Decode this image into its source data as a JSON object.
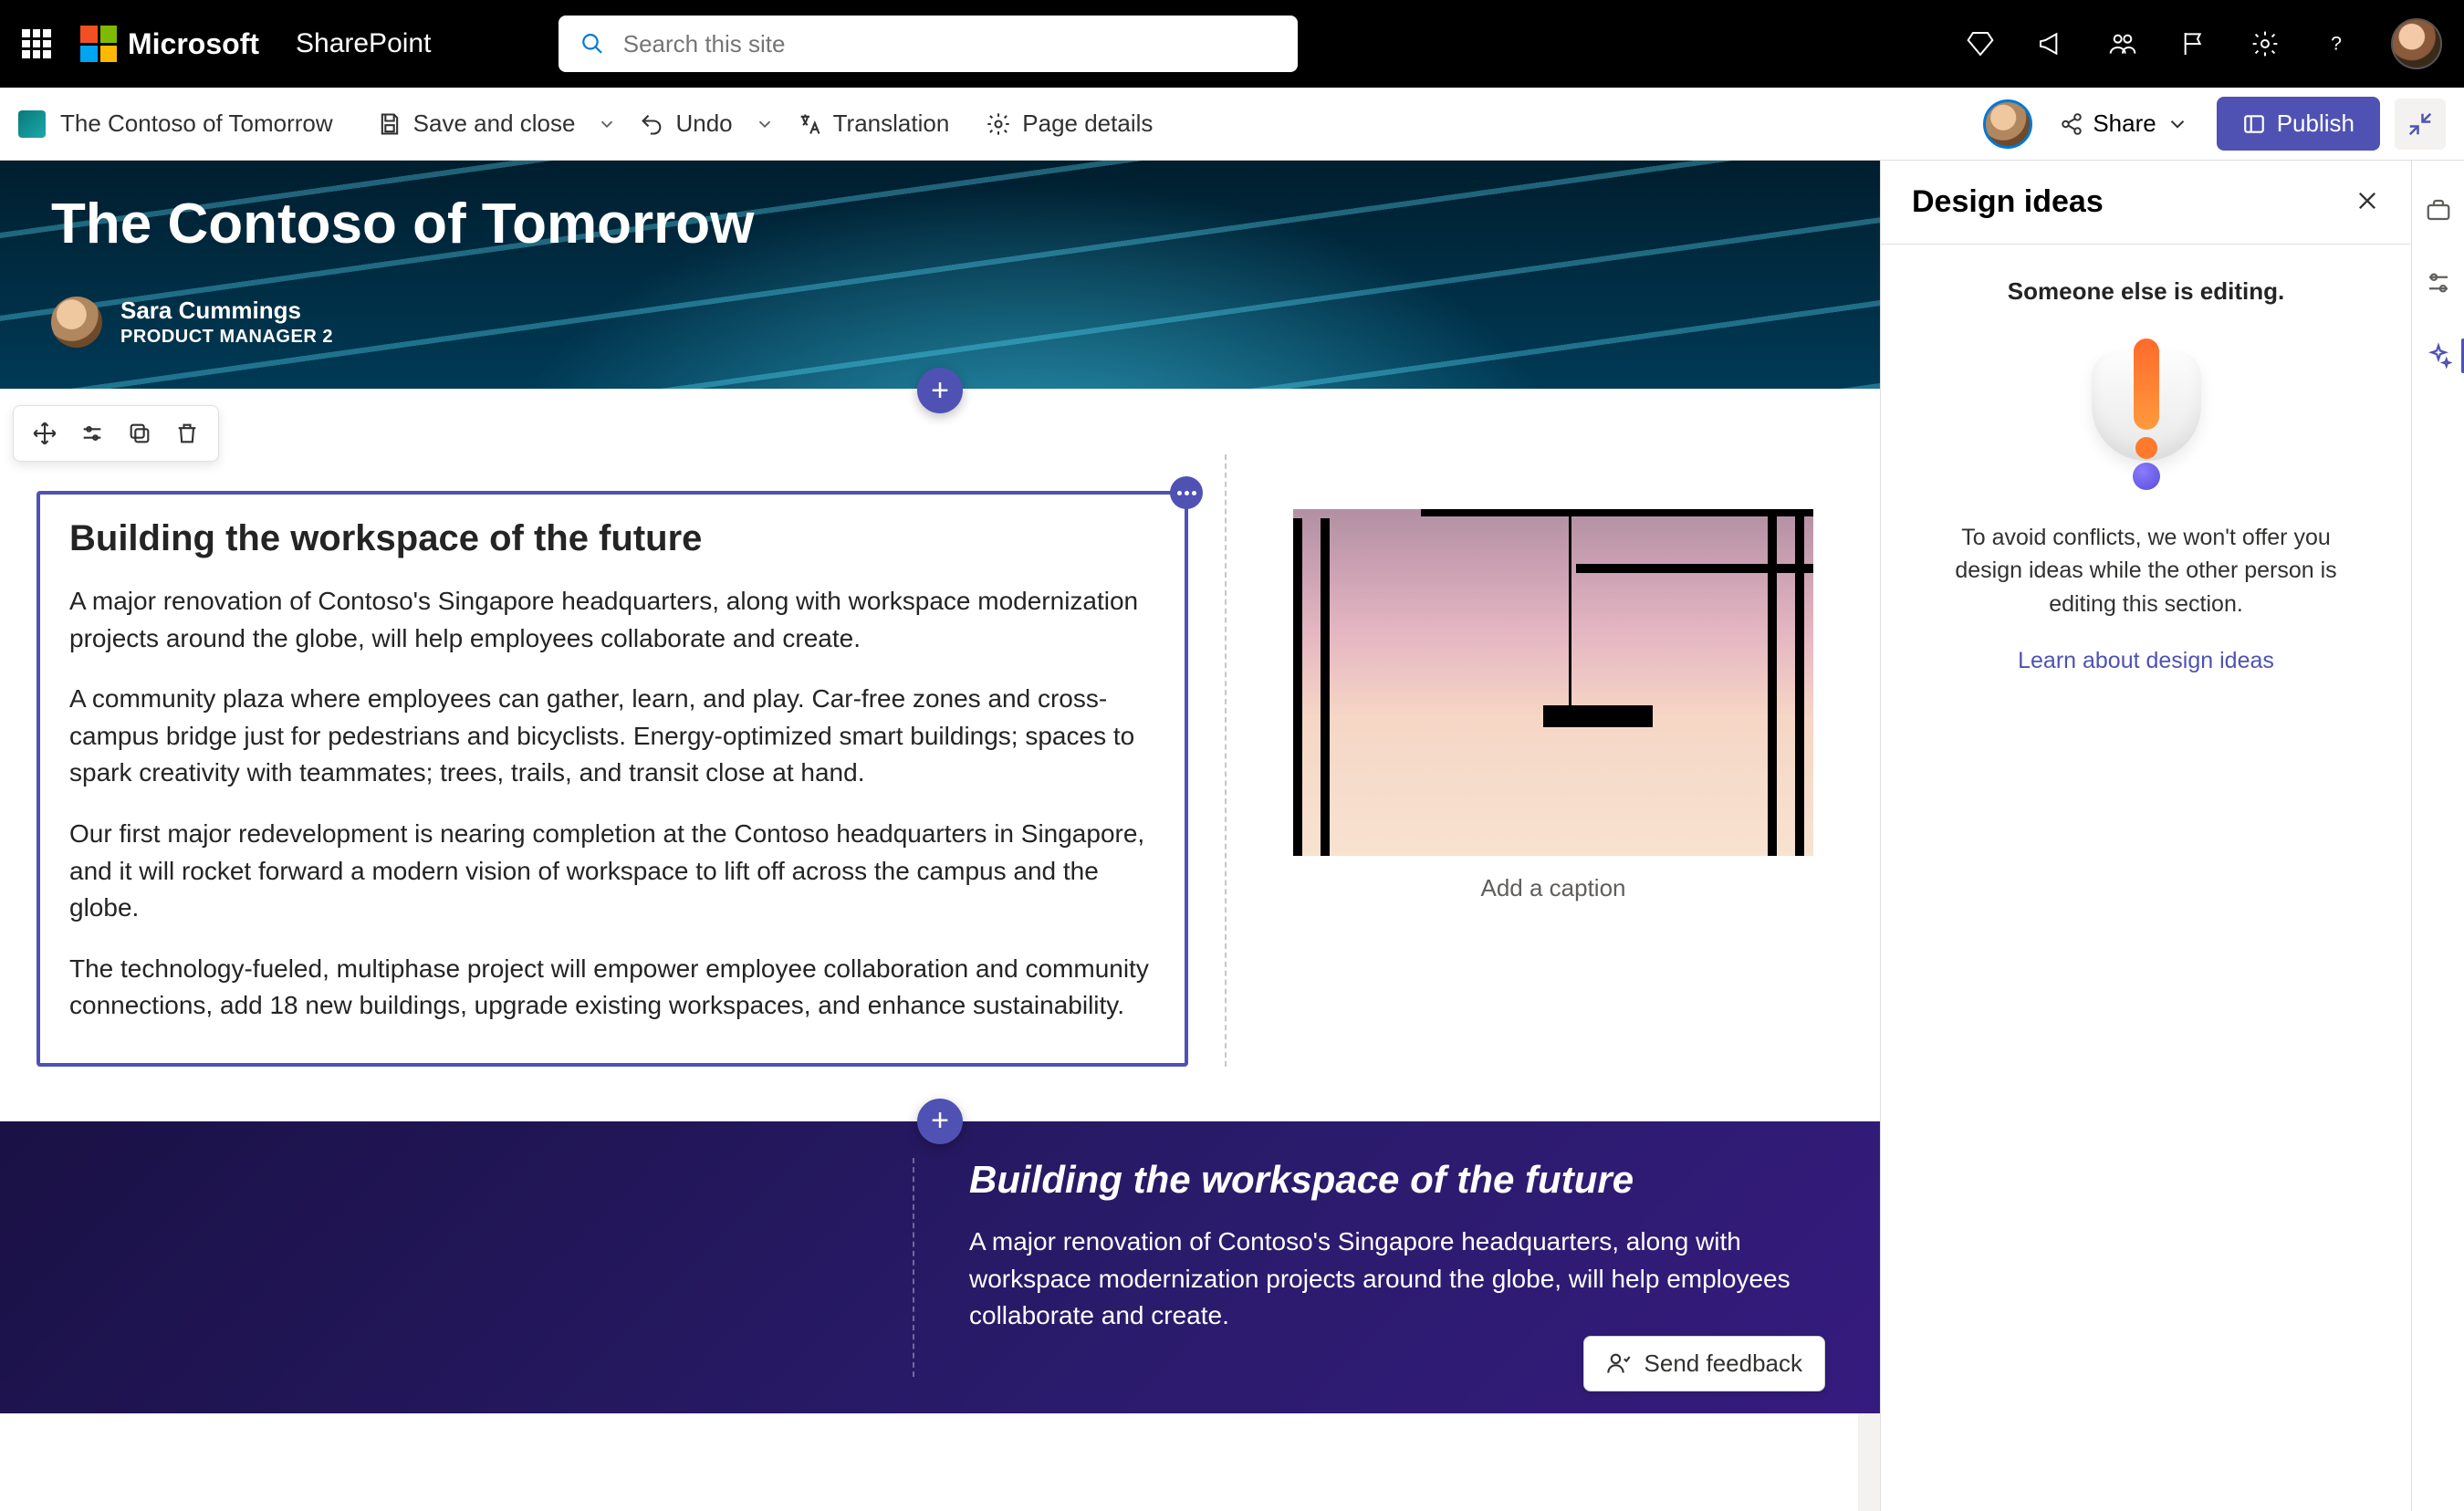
{
  "suite": {
    "brand": "Microsoft",
    "app": "SharePoint",
    "search_placeholder": "Search this site"
  },
  "commandBar": {
    "siteName": "The Contoso of Tomorrow",
    "save": "Save and close",
    "undo": "Undo",
    "translation": "Translation",
    "pageDetails": "Page details",
    "share": "Share",
    "publish": "Publish"
  },
  "hero": {
    "title": "The Contoso of Tomorrow",
    "authorName": "Sara Cummings",
    "authorTitle": "PRODUCT MANAGER 2"
  },
  "section1": {
    "heading": "Building the workspace of the future",
    "p1": "A major renovation of Contoso's Singapore headquarters, along with workspace modernization projects around the globe, will help employees collaborate and create.",
    "p2": "A community plaza where employees can gather, learn, and play. Car-free zones and cross-campus bridge just for pedestrians and bicyclists. Energy-optimized smart buildings; spaces to spark creativity with teammates; trees, trails, and transit close at hand.",
    "p3": "Our first major redevelopment is nearing completion at the Contoso headquarters in Singapore, and it will rocket forward a modern vision of workspace to lift off across the campus and the globe.",
    "p4": "The technology-fueled, multiphase project will empower employee collaboration and community connections, add 18 new buildings, upgrade existing workspaces, and enhance sustainability.",
    "captionPlaceholder": "Add a caption"
  },
  "section2": {
    "heading": "Building the workspace of the future",
    "p1": "A major renovation of Contoso's Singapore headquarters, along with workspace modernization projects around the globe, will help employees collaborate and create."
  },
  "pane": {
    "title": "Design ideas",
    "subtitle": "Someone else is editing.",
    "message": "To avoid conflicts, we won't offer you design ideas while the other person is editing this section.",
    "link": "Learn about design ideas"
  },
  "feedback": {
    "label": "Send feedback"
  }
}
